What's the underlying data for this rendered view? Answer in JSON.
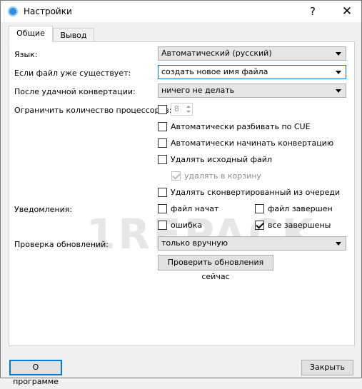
{
  "window": {
    "title": "Настройки",
    "help_symbol": "?",
    "close_symbol": "✕"
  },
  "tabs": [
    {
      "label": "Общие",
      "active": true
    },
    {
      "label": "Вывод",
      "active": false
    }
  ],
  "general": {
    "language_label": "Язык:",
    "language_value": "Автоматический (русский)",
    "file_exists_label": "Если файл уже существует:",
    "file_exists_value": "создать новое имя файла",
    "after_conversion_label": "После удачной конвертации:",
    "after_conversion_value": "ничего не делать",
    "limit_processors_label": "Ограничить количество процессоров:",
    "limit_processors_checked": false,
    "processors_count": "8",
    "options": [
      {
        "label": "Автоматически разбивать по CUE",
        "checked": false
      },
      {
        "label": "Автоматически начинать конвертацию",
        "checked": false
      },
      {
        "label": "Удалять исходный файл",
        "checked": false
      }
    ],
    "recycle_bin": {
      "label": "удалять в корзину",
      "checked": true,
      "disabled": true
    },
    "remove_from_queue": {
      "label": "Удалять сконвертированный из очереди",
      "checked": false
    },
    "notifications_label": "Уведомления:",
    "notifications": {
      "file_started": {
        "label": "файл начат",
        "checked": false
      },
      "file_finished": {
        "label": "файл завершен",
        "checked": false
      },
      "error": {
        "label": "ошибка",
        "checked": false
      },
      "all_finished": {
        "label": "все завершены",
        "checked": true
      }
    },
    "updates_label": "Проверка обновлений:",
    "updates_value": "только вручную",
    "check_updates_button": "Проверить обновления сейчас"
  },
  "watermark": "1REPACK",
  "footer": {
    "about_button": "О программе",
    "close_button": "Закрыть"
  },
  "colors": {
    "accent": "#0078d7",
    "app_icon": "#2f8fe0"
  }
}
